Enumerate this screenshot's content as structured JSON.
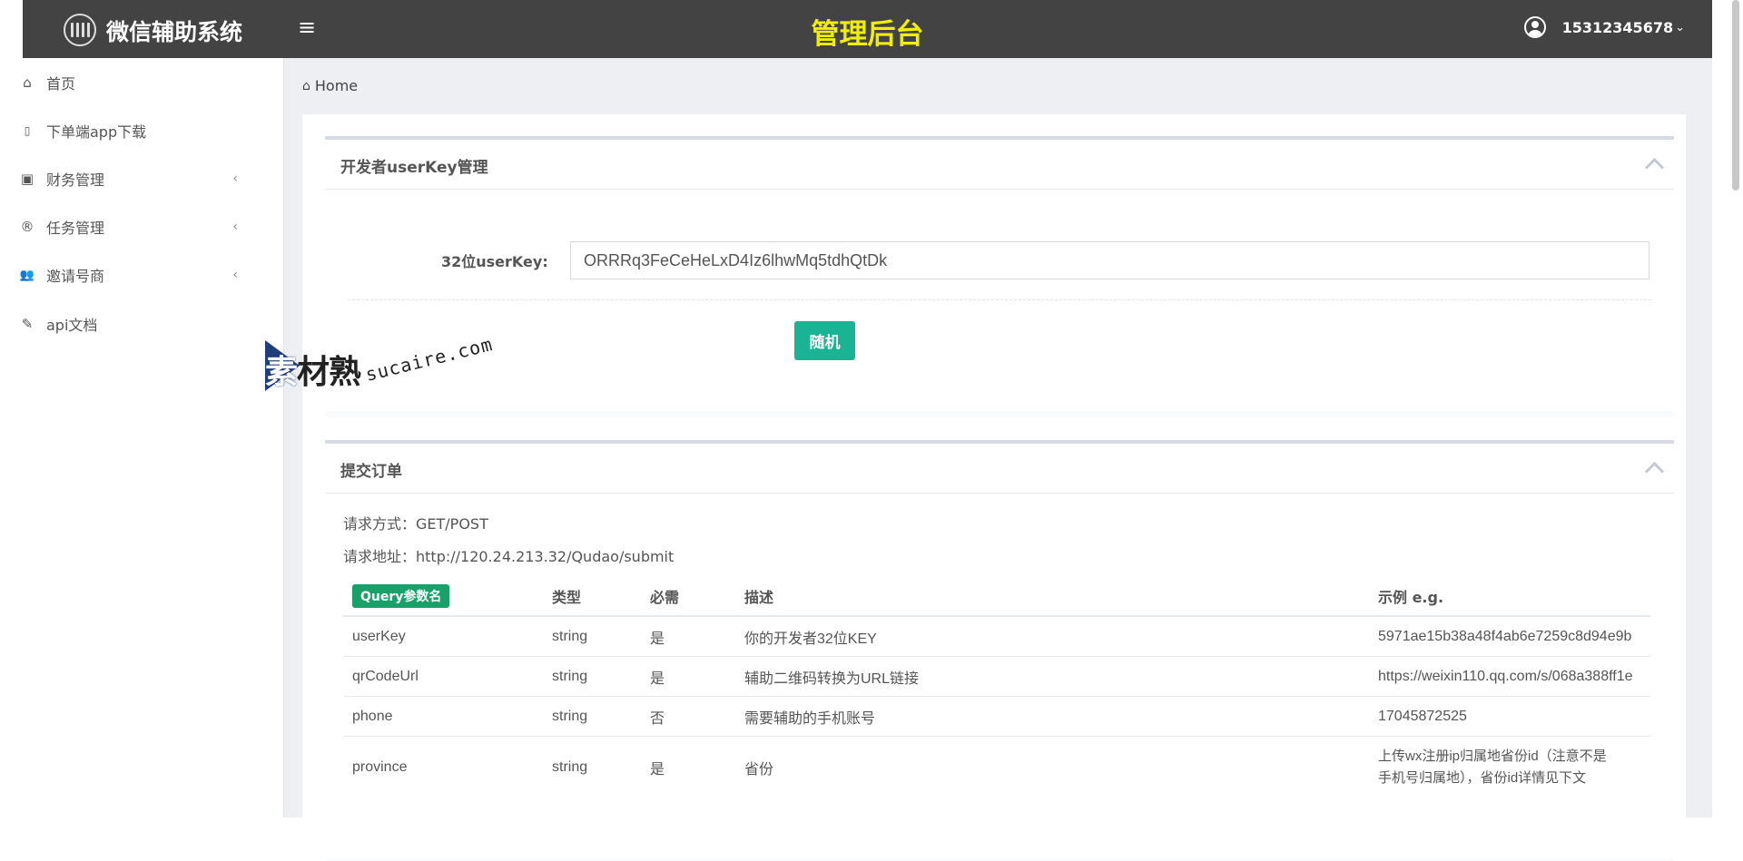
{
  "header": {
    "brand": "微信辅助系统",
    "menu_toggle": "≡",
    "title": "管理后台",
    "user": "15312345678",
    "user_caret": "⌄"
  },
  "sidebar": {
    "items": [
      {
        "label": "首页",
        "icon": "home-icon",
        "glyph": "⌂",
        "has_arrow": false
      },
      {
        "label": "下单端app下载",
        "icon": "mobile-icon",
        "glyph": "▯",
        "has_arrow": false
      },
      {
        "label": "财务管理",
        "icon": "money-icon",
        "glyph": "▣",
        "has_arrow": true
      },
      {
        "label": "任务管理",
        "icon": "registered-icon",
        "glyph": "®",
        "has_arrow": true
      },
      {
        "label": "邀请号商",
        "icon": "users-icon",
        "glyph": "👥",
        "has_arrow": true
      },
      {
        "label": "api文档",
        "icon": "pencil-icon",
        "glyph": "✎",
        "has_arrow": false
      }
    ],
    "arrow_glyph": "‹"
  },
  "breadcrumb": {
    "home_glyph": "⌂",
    "label": "Home"
  },
  "userkey_panel": {
    "title": "开发者userKey管理",
    "field_label": "32位userKey:",
    "field_value": "ORRRq3FeCeHeLxD4Iz6lhwMq5tdhQtDk",
    "random_button": "随机"
  },
  "watermark": {
    "cn": "素材熟",
    "cn_first": "素",
    "cn_rest": "材熟",
    "en": "sucaire.com"
  },
  "order_panel": {
    "title": "提交订单",
    "method_line": "请求方式：GET/POST",
    "url_line": "请求地址：http://120.24.213.32/Qudao/submit",
    "table": {
      "headers": [
        "Query参数名",
        "类型",
        "必需",
        "描述",
        "示例 e.g."
      ],
      "rows": [
        {
          "name": "userKey",
          "type": "string",
          "required": "是",
          "desc": "你的开发者32位KEY",
          "example": "5971ae15b38a48f4ab6e7259c8d94e9b"
        },
        {
          "name": "qrCodeUrl",
          "type": "string",
          "required": "是",
          "desc": "辅助二维码转换为URL链接",
          "example": "https://weixin110.qq.com/s/068a388ff1e"
        },
        {
          "name": "phone",
          "type": "string",
          "required": "否",
          "desc": "需要辅助的手机账号",
          "example": "17045872525"
        },
        {
          "name": "province",
          "type": "string",
          "required": "是",
          "desc": "省份",
          "example_line1": "上传wx注册ip归属地省份id（注意不是",
          "example_line2": "手机号归属地），省份id详情见下文"
        }
      ]
    }
  },
  "colors": {
    "header_bg": "#434343",
    "title": "#f1ee00",
    "button": "#1ab394",
    "badge": "#1aa069"
  }
}
